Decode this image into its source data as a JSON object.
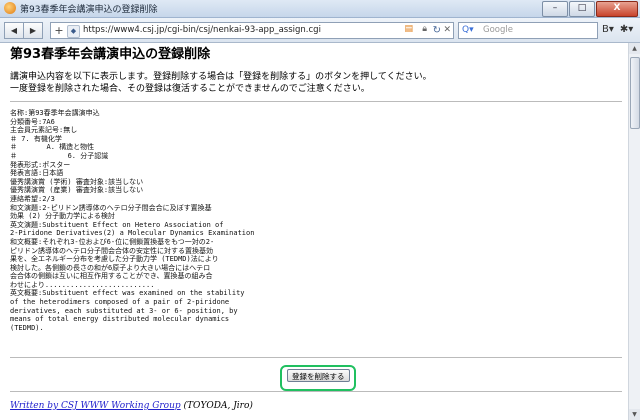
{
  "window": {
    "title": "第93春季年会講演申込の登録削除",
    "minimize": "–",
    "maximize": "□",
    "close": "X"
  },
  "toolbar": {
    "url": "https://www4.csj.jp/cgi-bin/csj/nenkai-93-app_assign.cgi",
    "search_placeholder": "Google",
    "back_icon": "◀",
    "forward_icon": "▶",
    "new_tab": "+",
    "page_menu_icon": "B▾",
    "tools_menu_icon": "✱▾"
  },
  "page": {
    "title": "第93春季年会講演申込の登録削除",
    "intro_line1": "講演申込内容を以下に表示します。登録削除する場合は「登録を削除する」のボタンを押してください。",
    "intro_line2": "一度登録を削除された場合、その登録は復活することができませんのでご注意ください。",
    "record_lines": [
      "名称:第93春季年会講演申込",
      "分類番号:7A6",
      "主会員元素記号:無し",
      "＃ 7. 有機化学",
      "＃       A. 構造と物性",
      "＃            6. 分子認識",
      "発表形式:ポスター",
      "発表言語:日本語",
      "優秀講演賞 (学術) 審査対象:該当しない",
      "優秀講演賞 (産業) 審査対象:該当しない",
      "連絡希望:2/3",
      "和文演題:2-ピリドン誘導体のヘテロ分子間会合に及ぼす置換基",
      "効果 (2) 分子動力学による検討",
      "英文演題:Substituent Effect on Hetero Association of",
      "2-Piridone Derivatives(2) a Molecular Dynamics Examination",
      "和文概要:それぞれ3-位および6-位に側鎖置換基をもつ一対の2-",
      "ピリドン誘導体のヘテロ分子間会合体の安定性に対する置換基効",
      "果を、全エネルギー分布を考慮した分子動力学 (TEDMD)法により",
      "検討した。各側鎖の長さの和が6原子より大きい場合にはヘテロ",
      "会合体の側鎖は互いに相互作用することができ、置換基の組み合",
      "わせにより..........................",
      "英文概要:Substituent effect was examined on the stability",
      "of the heterodimers composed of a pair of 2-piridone",
      "derivatives, each substituted at 3- or 6- position, by",
      "means of total energy distributed molecular dynamics",
      "(TEDMD)."
    ],
    "delete_button": "登録を削除する",
    "footer_link": "Written by CSJ WWW Working Group",
    "footer_author": "(TOYODA, Jiro)"
  },
  "colors": {
    "highlight": "#20c060",
    "link": "#2222cc"
  }
}
